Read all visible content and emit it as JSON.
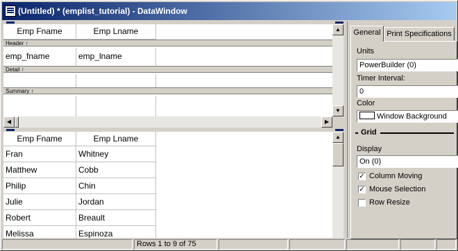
{
  "window": {
    "title": "(Untitled) * (emplist_tutorial) - DataWindow"
  },
  "design": {
    "columns": [
      "Emp Fname",
      "Emp Lname"
    ],
    "detail_fields": [
      "emp_fname",
      "emp_lname"
    ],
    "bands": {
      "header": "Header ↑",
      "detail": "Detail ↑",
      "summary": "Summary ↑"
    }
  },
  "preview": {
    "columns": [
      "Emp Fname",
      "Emp Lname"
    ],
    "rows": [
      [
        "Fran",
        "Whitney"
      ],
      [
        "Matthew",
        "Cobb"
      ],
      [
        "Philip",
        "Chin"
      ],
      [
        "Julie",
        "Jordan"
      ],
      [
        "Robert",
        "Breault"
      ],
      [
        "Melissa",
        "Espinoza"
      ]
    ]
  },
  "properties": {
    "tabs": [
      "General",
      "Print Specifications"
    ],
    "units_label": "Units",
    "units_value": "PowerBuilder (0)",
    "timer_label": "Timer Interval:",
    "timer_value": "0",
    "color_label": "Color",
    "color_value": "Window Background",
    "grid_section": "Grid",
    "display_label": "Display",
    "display_value": "On (0)",
    "column_moving_label": "Column Moving",
    "column_moving_checked": true,
    "mouse_selection_label": "Mouse Selection",
    "mouse_selection_checked": true,
    "row_resize_label": "Row Resize",
    "row_resize_checked": false
  },
  "status": {
    "rows_text": "Rows 1 to 9 of 75"
  },
  "colors": {
    "title_start": "#0a246a",
    "title_end": "#a6caf0",
    "face": "#d4d0c8"
  }
}
